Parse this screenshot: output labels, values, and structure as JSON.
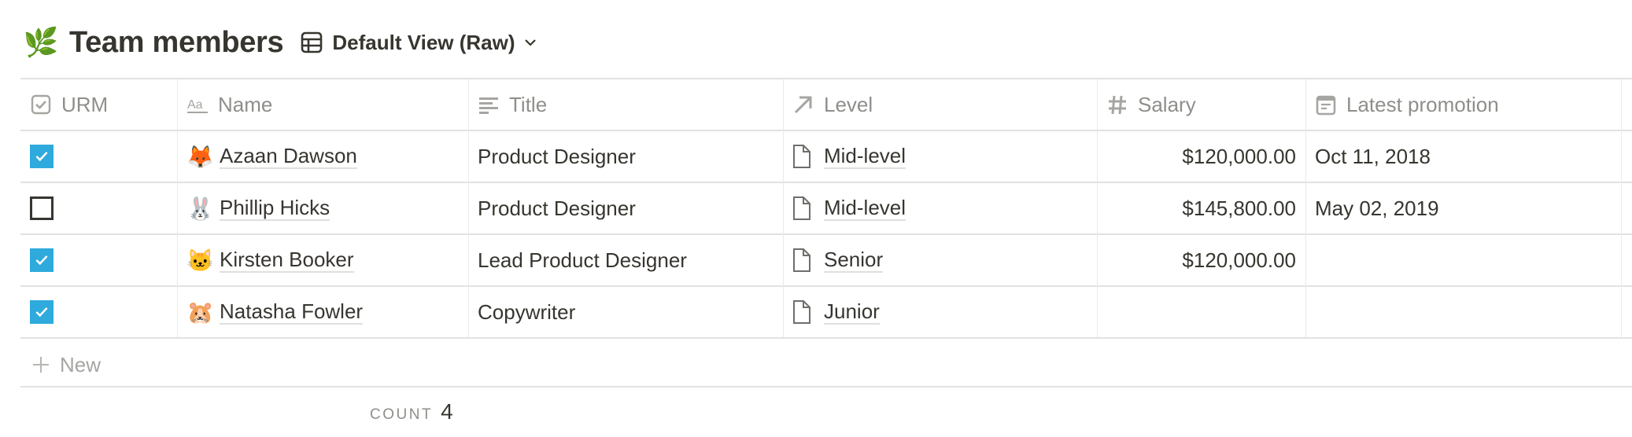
{
  "page": {
    "icon": "🌿",
    "icon_name": "herb-icon",
    "title": "Team members",
    "view_icon": "table-icon",
    "view_label": "Default View (Raw)",
    "view_chevron": "chevron-down-icon"
  },
  "table": {
    "columns": [
      {
        "key": "urm",
        "label": "URM",
        "icon": "checkbox-property-icon"
      },
      {
        "key": "name",
        "label": "Name",
        "icon": "text-title-icon"
      },
      {
        "key": "title",
        "label": "Title",
        "icon": "text-lines-icon"
      },
      {
        "key": "level",
        "label": "Level",
        "icon": "relation-arrow-icon"
      },
      {
        "key": "salary",
        "label": "Salary",
        "icon": "number-hash-icon"
      },
      {
        "key": "latest_promotion",
        "label": "Latest promotion",
        "icon": "calendar-icon"
      }
    ],
    "rows": [
      {
        "urm": true,
        "emoji": "🦊",
        "name": "Azaan Dawson",
        "title": "Product Designer",
        "level": "Mid-level",
        "salary": "$120,000.00",
        "latest_promotion": "Oct 11, 2018"
      },
      {
        "urm": false,
        "emoji": "🐰",
        "name": "Phillip Hicks",
        "title": "Product Designer",
        "level": "Mid-level",
        "salary": "$145,800.00",
        "latest_promotion": "May 02, 2019"
      },
      {
        "urm": true,
        "emoji": "🐱",
        "name": "Kirsten Booker",
        "title": "Lead Product Designer",
        "level": "Senior",
        "salary": "$120,000.00",
        "latest_promotion": ""
      },
      {
        "urm": true,
        "emoji": "🐹",
        "name": "Natasha Fowler",
        "title": "Copywriter",
        "level": "Junior",
        "salary": "",
        "latest_promotion": ""
      }
    ],
    "new_label": "New",
    "count_label": "COUNT",
    "count_value": "4"
  },
  "colors": {
    "checkbox_checked": "#2eaadc",
    "text": "#37352f",
    "muted": "#8f8e8a",
    "border": "#e3e2e0"
  }
}
